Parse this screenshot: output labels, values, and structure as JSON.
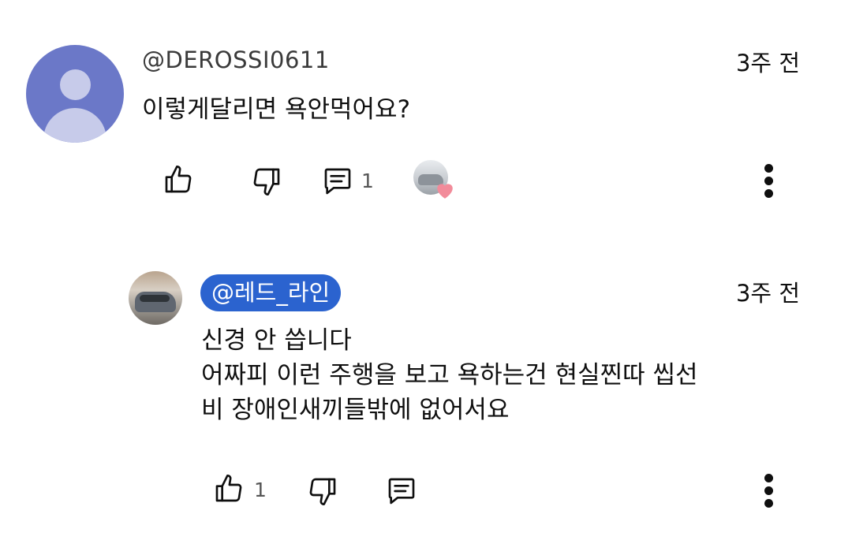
{
  "comment": {
    "author": "@DEROSSI0611",
    "time": "3주 전",
    "text": "이렇게달리면 욕안먹어요?",
    "like_icon": "thumbs-up-icon",
    "dislike_icon": "thumbs-down-icon",
    "reply_icon": "comment-icon",
    "reply_count": "1",
    "creator_heart_icon": "heart-icon"
  },
  "reply": {
    "author": "@레드_라인",
    "author_badge_color": "#2b63cf",
    "time": "3주 전",
    "text_lines": [
      "신경 안 씁니다",
      "어짜피 이런 주행을 보고 욕하는건 현실찐따 씹선",
      "비 장애인새끼들밖에 없어서요"
    ],
    "like_count": "1"
  },
  "colors": {
    "default_avatar_bg": "#6b78c8",
    "heart": "#f28b9a",
    "text": "#0f0f0f"
  }
}
